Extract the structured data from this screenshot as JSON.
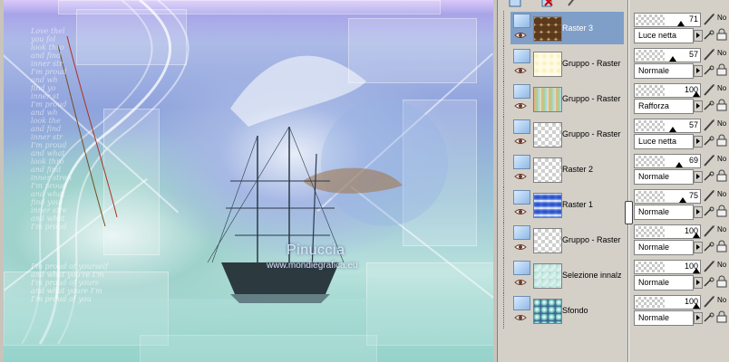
{
  "canvas": {
    "watermark_name": "Pinuccia",
    "watermark_url": "www.mondiegrafica.eu",
    "script_lines": "Love thel\nyou fol\nlook thro\nand find\ninner str\nI'm proud\nand wh\nfind yo\ninner st\nI'm proud\nand wh\nlook the\nand find\ninner str\nI'm proud\nand what\nlook thro\nand find\ninner stren\nI'm proud\nand what\nfind you\ninner stre\nand what\nI'm proud",
    "script_bottom": "I'm proud of yourself\nand what you're I'm\nI'm proud of yours\nand what youre I'm\nI'm proud of you"
  },
  "layers": [
    {
      "name": "Raster 3",
      "opacity": "71",
      "blend": "Luce netta",
      "thumb": "sepia",
      "selected": true
    },
    {
      "name": "Gruppo - Raster",
      "opacity": "57",
      "blend": "Normale",
      "thumb": "yellow",
      "selected": false
    },
    {
      "name": "Gruppo - Raster",
      "opacity": "100",
      "blend": "Rafforza",
      "thumb": "orange",
      "selected": false
    },
    {
      "name": "Gruppo - Raster",
      "opacity": "57",
      "blend": "Luce netta",
      "thumb": "blank",
      "selected": false
    },
    {
      "name": "Raster 2",
      "opacity": "69",
      "blend": "Normale",
      "thumb": "blank",
      "selected": false
    },
    {
      "name": "Raster 1",
      "opacity": "75",
      "blend": "Normale",
      "thumb": "blue",
      "selected": false
    },
    {
      "name": "Gruppo - Raster",
      "opacity": "100",
      "blend": "Normale",
      "thumb": "blank",
      "selected": false
    },
    {
      "name": "Selezione innalz",
      "opacity": "100",
      "blend": "Normale",
      "thumb": "teal",
      "selected": false
    },
    {
      "name": "Sfondo",
      "opacity": "100",
      "blend": "Normale",
      "thumb": "colorful",
      "selected": false
    }
  ],
  "props_label": "No",
  "colors": {
    "selected_bg": "#7f9fc9",
    "panel_bg": "#d4d0c8"
  }
}
